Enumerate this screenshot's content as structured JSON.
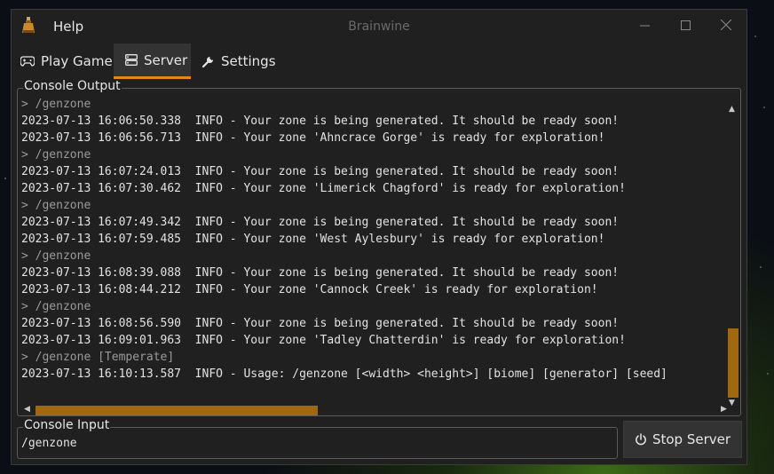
{
  "window": {
    "title": "Brainwine",
    "menu_help": "Help"
  },
  "tabs": [
    {
      "label": "Play Game",
      "icon": "gamepad-icon",
      "active": false
    },
    {
      "label": "Server",
      "icon": "server-icon",
      "active": true
    },
    {
      "label": "Settings",
      "icon": "wrench-icon",
      "active": false
    }
  ],
  "console_output": {
    "label": "Console Output",
    "lines": [
      {
        "text": "> /genzone",
        "type": "cmd"
      },
      {
        "text": "2023-07-13 16:06:50.338  INFO - Your zone is being generated. It should be ready soon!",
        "type": "log"
      },
      {
        "text": "2023-07-13 16:06:56.713  INFO - Your zone 'Ahncrace Gorge' is ready for exploration!",
        "type": "log"
      },
      {
        "text": "> /genzone",
        "type": "cmd"
      },
      {
        "text": "2023-07-13 16:07:24.013  INFO - Your zone is being generated. It should be ready soon!",
        "type": "log"
      },
      {
        "text": "2023-07-13 16:07:30.462  INFO - Your zone 'Limerick Chagford' is ready for exploration!",
        "type": "log"
      },
      {
        "text": "> /genzone",
        "type": "cmd"
      },
      {
        "text": "2023-07-13 16:07:49.342  INFO - Your zone is being generated. It should be ready soon!",
        "type": "log"
      },
      {
        "text": "2023-07-13 16:07:59.485  INFO - Your zone 'West Aylesbury' is ready for exploration!",
        "type": "log"
      },
      {
        "text": "> /genzone",
        "type": "cmd"
      },
      {
        "text": "2023-07-13 16:08:39.088  INFO - Your zone is being generated. It should be ready soon!",
        "type": "log"
      },
      {
        "text": "2023-07-13 16:08:44.212  INFO - Your zone 'Cannock Creek' is ready for exploration!",
        "type": "log"
      },
      {
        "text": "> /genzone",
        "type": "cmd"
      },
      {
        "text": "2023-07-13 16:08:56.590  INFO - Your zone is being generated. It should be ready soon!",
        "type": "log"
      },
      {
        "text": "2023-07-13 16:09:01.963  INFO - Your zone 'Tadley Chatterdin' is ready for exploration!",
        "type": "log"
      },
      {
        "text": "> /genzone [Temperate]",
        "type": "cmd"
      },
      {
        "text": "2023-07-13 16:10:13.587  INFO - Usage: /genzone [<width> <height>] [biome] [generator] [seed]",
        "type": "log"
      }
    ],
    "vertical_scroll_position": 1.0,
    "horizontal_scroll_position": 0.0
  },
  "console_input": {
    "label": "Console Input",
    "value": "/genzone"
  },
  "stop_button": {
    "label": "Stop Server"
  },
  "colors": {
    "accent": "#e28a18",
    "scrollbar": "#a0680f",
    "background": "#202020"
  }
}
